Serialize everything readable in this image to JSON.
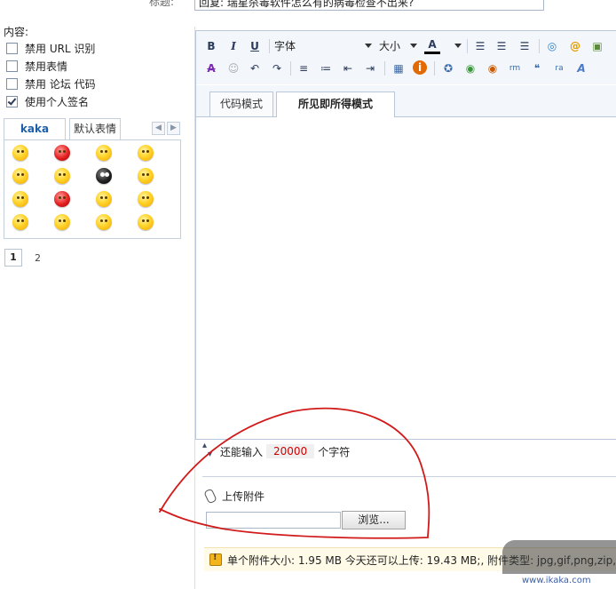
{
  "subject": {
    "label": "标题:",
    "value": "回复: 瑞星杀毒软件怎么有的病毒检查不出来?"
  },
  "content_label": "内容:",
  "options": [
    {
      "label": "禁用 URL 识别",
      "checked": false
    },
    {
      "label": "禁用表情",
      "checked": false
    },
    {
      "label": "禁用 论坛 代码",
      "checked": false
    },
    {
      "label": "使用个人签名",
      "checked": true
    }
  ],
  "smilies": {
    "tabs": [
      "kaka",
      "默认表情"
    ],
    "prev_icon": "chevron-left-icon",
    "next_icon": "chevron-right-icon",
    "pages": [
      "1",
      "2"
    ]
  },
  "toolbar": {
    "bold": "B",
    "italic": "I",
    "underline": "U",
    "font_label": "字体",
    "size_label": "大小",
    "color_label": "A"
  },
  "mode_tabs": {
    "code": "代码模式",
    "wysiwyg": "所见即所得模式"
  },
  "counter": {
    "prefix": "还能输入",
    "value": "20000",
    "suffix": "个字符"
  },
  "upload": {
    "label": "上传附件",
    "browse": "浏览..."
  },
  "attach_info": "单个附件大小: 1.95 MB  今天还可以上传: 19.43 MB;,  附件类型: jpg,gif,png,zip,r",
  "watermark": {
    "logo_text": "",
    "url": "www.ikaka.com"
  },
  "colors": {
    "annotation": "#d11a1a",
    "tab_active": "#1d5fa8",
    "counter": "#d40000"
  }
}
